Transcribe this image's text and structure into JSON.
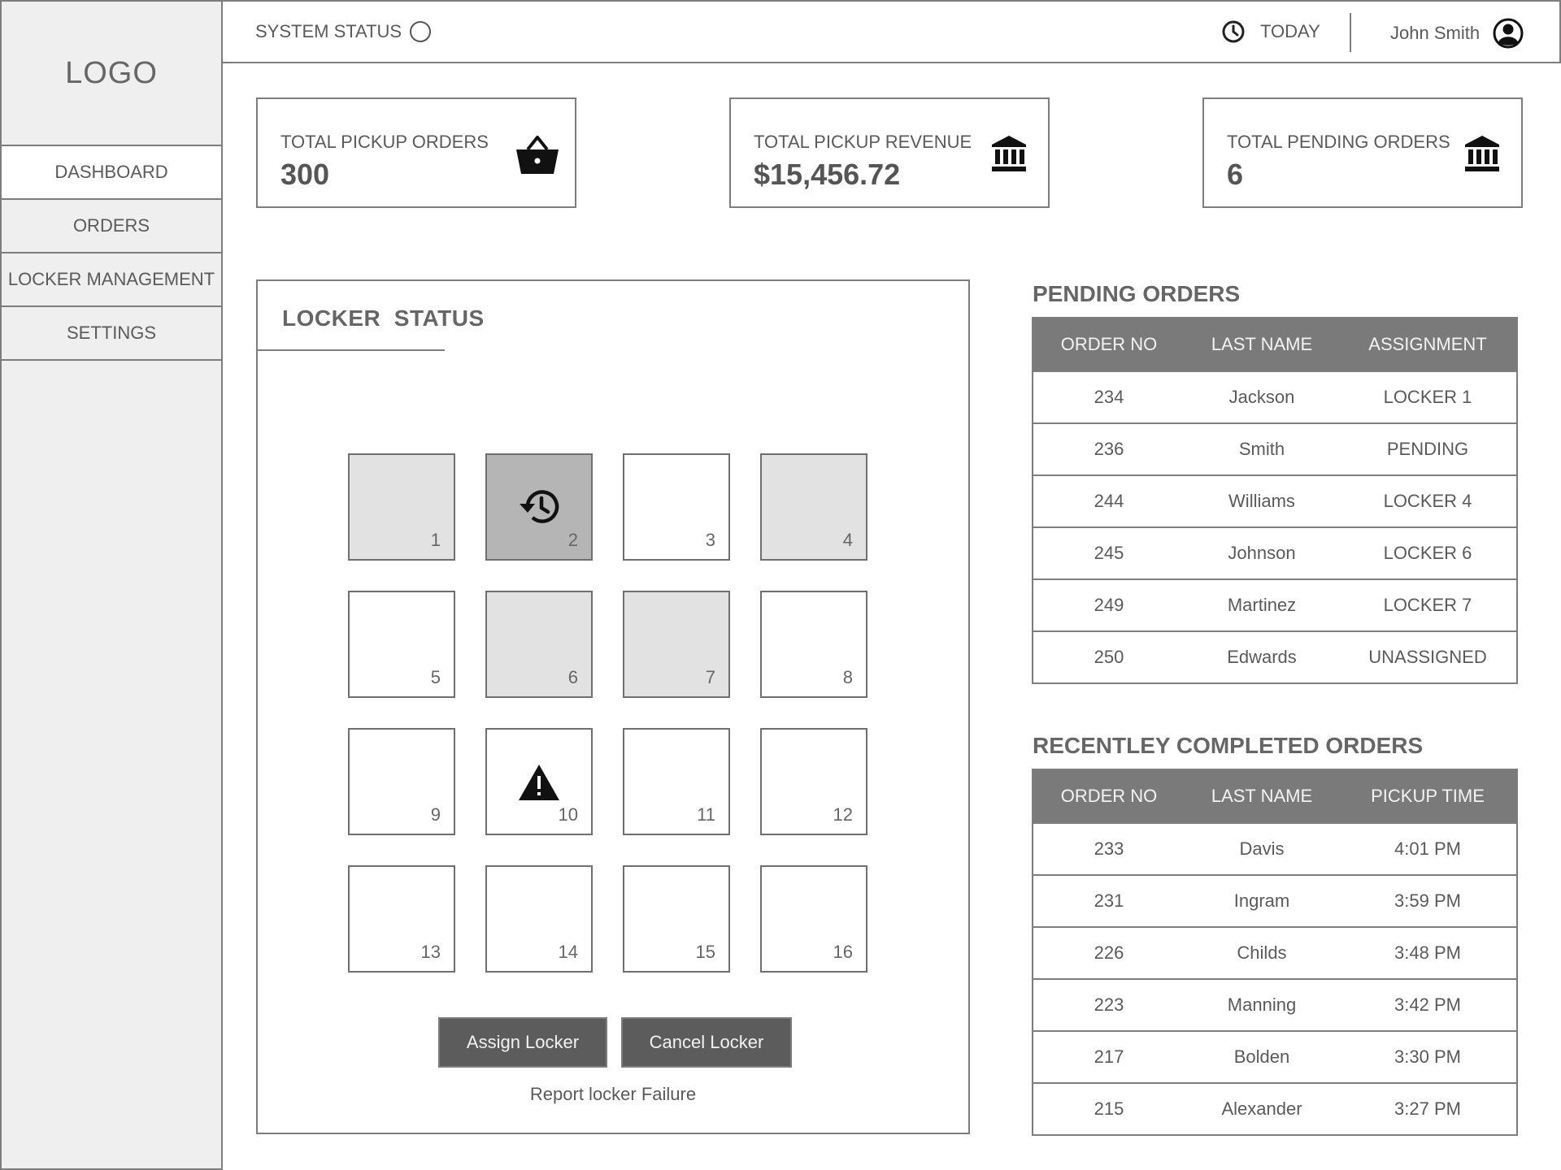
{
  "sidebar": {
    "logo": "LOGO",
    "items": [
      {
        "label": "DASHBOARD",
        "active": true
      },
      {
        "label": "ORDERS",
        "active": false
      },
      {
        "label": "LOCKER MANAGEMENT",
        "active": false
      },
      {
        "label": "SETTINGS",
        "active": false
      }
    ]
  },
  "header": {
    "system_status": "SYSTEM STATUS",
    "today": "TODAY",
    "user_name": "John Smith"
  },
  "stats": {
    "pickup_orders": {
      "label": "TOTAL PICKUP ORDERS",
      "value": "300",
      "icon": "basket-icon"
    },
    "pickup_revenue": {
      "label": "TOTAL PICKUP REVENUE",
      "value": "$15,456.72",
      "icon": "bank-icon"
    },
    "pending_orders": {
      "label": "TOTAL PENDING ORDERS",
      "value": "6",
      "icon": "bank-icon"
    }
  },
  "locker_status": {
    "title": "LOCKER  STATUS",
    "lockers": [
      {
        "num": "1",
        "state": "occupied"
      },
      {
        "num": "2",
        "state": "selected",
        "icon": "history-icon"
      },
      {
        "num": "3",
        "state": "empty"
      },
      {
        "num": "4",
        "state": "occupied"
      },
      {
        "num": "5",
        "state": "empty"
      },
      {
        "num": "6",
        "state": "occupied"
      },
      {
        "num": "7",
        "state": "occupied"
      },
      {
        "num": "8",
        "state": "empty"
      },
      {
        "num": "9",
        "state": "empty"
      },
      {
        "num": "10",
        "state": "empty",
        "icon": "warning-icon"
      },
      {
        "num": "11",
        "state": "empty"
      },
      {
        "num": "12",
        "state": "empty"
      },
      {
        "num": "13",
        "state": "empty"
      },
      {
        "num": "14",
        "state": "empty"
      },
      {
        "num": "15",
        "state": "empty"
      },
      {
        "num": "16",
        "state": "empty"
      }
    ],
    "assign_label": "Assign Locker",
    "cancel_label": "Cancel Locker",
    "report_label": "Report locker Failure"
  },
  "pending_orders": {
    "title": "PENDING ORDERS",
    "columns": [
      "ORDER NO",
      "LAST NAME",
      "ASSIGNMENT"
    ],
    "rows": [
      [
        "234",
        "Jackson",
        "LOCKER 1"
      ],
      [
        "236",
        "Smith",
        "PENDING"
      ],
      [
        "244",
        "Williams",
        "LOCKER 4"
      ],
      [
        "245",
        "Johnson",
        "LOCKER 6"
      ],
      [
        "249",
        "Martinez",
        "LOCKER 7"
      ],
      [
        "250",
        "Edwards",
        "UNASSIGNED"
      ]
    ]
  },
  "completed_orders": {
    "title": "RECENTLEY COMPLETED ORDERS",
    "columns": [
      "ORDER NO",
      "LAST NAME",
      "PICKUP TIME"
    ],
    "rows": [
      [
        "233",
        "Davis",
        "4:01 PM"
      ],
      [
        "231",
        "Ingram",
        "3:59 PM"
      ],
      [
        "226",
        "Childs",
        "3:48 PM"
      ],
      [
        "223",
        "Manning",
        "3:42 PM"
      ],
      [
        "217",
        "Bolden",
        "3:30 PM"
      ],
      [
        "215",
        "Alexander",
        "3:27 PM"
      ]
    ]
  }
}
